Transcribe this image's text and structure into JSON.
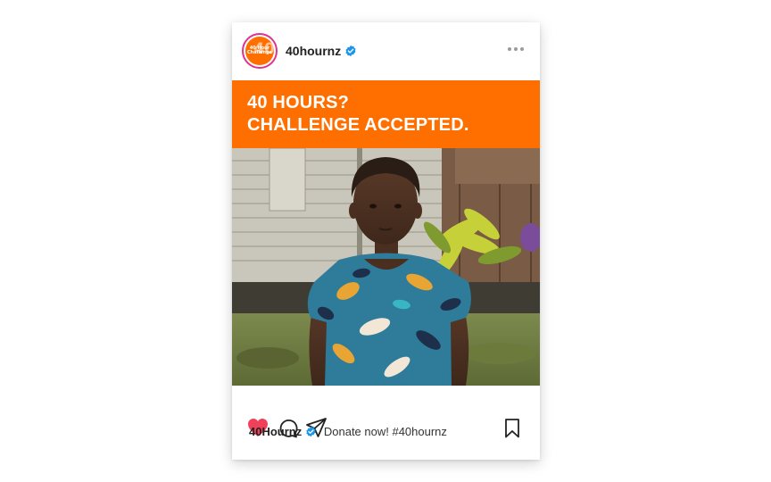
{
  "post": {
    "username": "40hournz",
    "avatar_text": [
      "40 Hour",
      "Challenge"
    ],
    "avatar_big": "40",
    "banner_lines": [
      "40 HOURS?",
      "CHALLENGE ACCEPTED."
    ],
    "caption_author": "40Hournz",
    "caption_text": "Donate now! #40hournz",
    "liked": true
  },
  "colors": {
    "brand_orange": "#ff6f00",
    "avatar_ring": "#e0338f",
    "verified_blue": "#1c96e8",
    "like_red": "#f0405a"
  },
  "icons": [
    "verified-icon",
    "more-icon",
    "heart-icon",
    "comment-icon",
    "share-icon",
    "bookmark-icon"
  ]
}
